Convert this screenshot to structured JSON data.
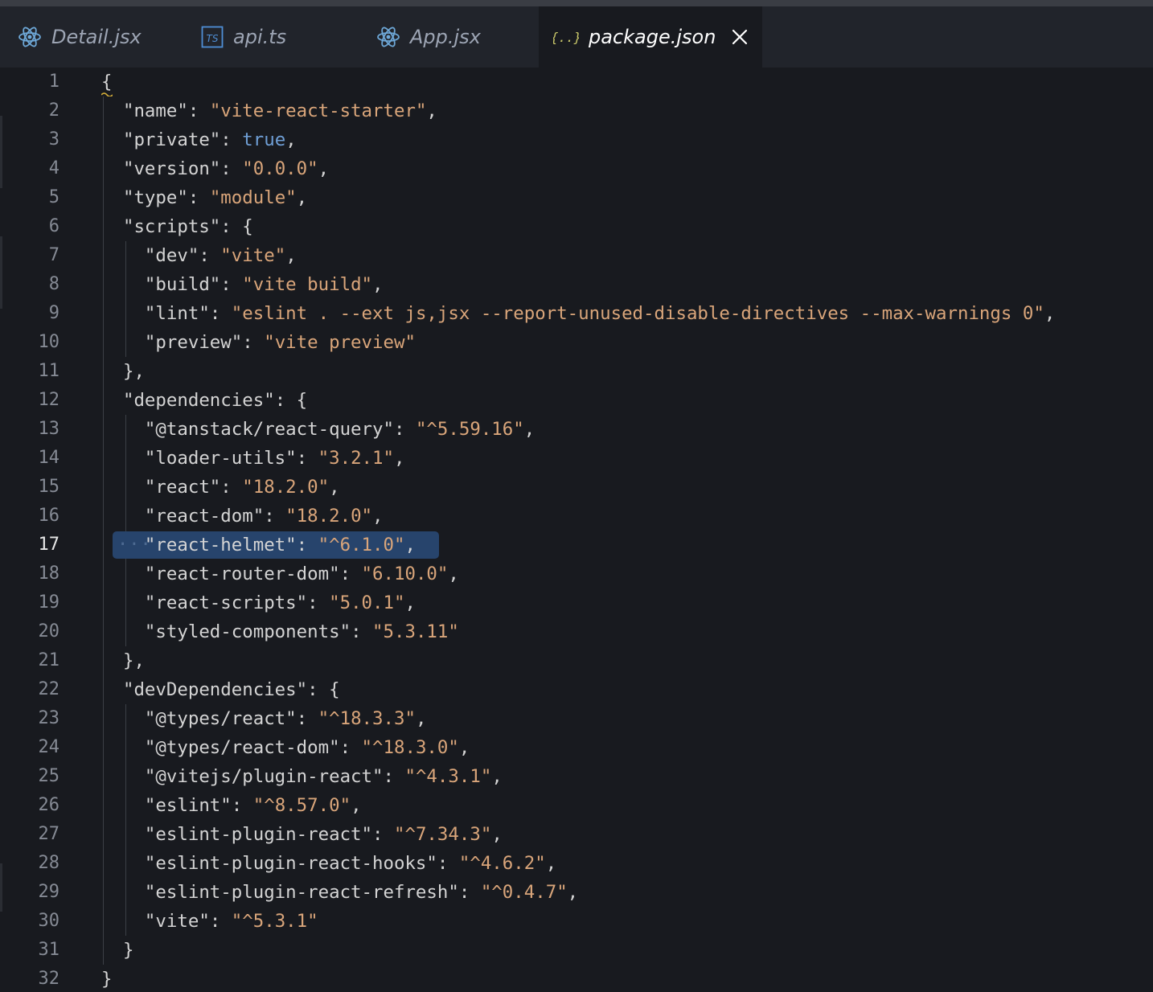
{
  "tabs": [
    {
      "label": "Detail.jsx",
      "icon": "react-icon",
      "active": false
    },
    {
      "label": "api.ts",
      "icon": "typescript-icon",
      "active": false
    },
    {
      "label": "App.jsx",
      "icon": "react-icon",
      "active": false
    },
    {
      "label": "package.json",
      "icon": "json-braces-icon",
      "active": true,
      "close_icon": "close-icon"
    }
  ],
  "editor": {
    "current_line": 17,
    "colors": {
      "background": "#181a1f",
      "string": "#d9a57a",
      "boolean": "#6f9fd6",
      "key": "#d4d4d4",
      "selection": "#27446c"
    },
    "lines": [
      {
        "n": "1",
        "tokens": [
          [
            "p",
            "{"
          ]
        ]
      },
      {
        "n": "2",
        "tokens": [
          [
            "k",
            "  \"name\""
          ],
          [
            "p",
            ": "
          ],
          [
            "s",
            "\"vite-react-starter\""
          ],
          [
            "p",
            ","
          ]
        ]
      },
      {
        "n": "3",
        "tokens": [
          [
            "k",
            "  \"private\""
          ],
          [
            "p",
            ": "
          ],
          [
            "b",
            "true"
          ],
          [
            "p",
            ","
          ]
        ]
      },
      {
        "n": "4",
        "tokens": [
          [
            "k",
            "  \"version\""
          ],
          [
            "p",
            ": "
          ],
          [
            "s",
            "\"0.0.0\""
          ],
          [
            "p",
            ","
          ]
        ]
      },
      {
        "n": "5",
        "tokens": [
          [
            "k",
            "  \"type\""
          ],
          [
            "p",
            ": "
          ],
          [
            "s",
            "\"module\""
          ],
          [
            "p",
            ","
          ]
        ]
      },
      {
        "n": "6",
        "tokens": [
          [
            "k",
            "  \"scripts\""
          ],
          [
            "p",
            ": {"
          ]
        ]
      },
      {
        "n": "7",
        "tokens": [
          [
            "k",
            "    \"dev\""
          ],
          [
            "p",
            ": "
          ],
          [
            "s",
            "\"vite\""
          ],
          [
            "p",
            ","
          ]
        ]
      },
      {
        "n": "8",
        "tokens": [
          [
            "k",
            "    \"build\""
          ],
          [
            "p",
            ": "
          ],
          [
            "s",
            "\"vite build\""
          ],
          [
            "p",
            ","
          ]
        ]
      },
      {
        "n": "9",
        "tokens": [
          [
            "k",
            "    \"lint\""
          ],
          [
            "p",
            ": "
          ],
          [
            "s",
            "\"eslint . --ext js,jsx --report-unused-disable-directives --max-warnings 0\""
          ],
          [
            "p",
            ","
          ]
        ]
      },
      {
        "n": "10",
        "tokens": [
          [
            "k",
            "    \"preview\""
          ],
          [
            "p",
            ": "
          ],
          [
            "s",
            "\"vite preview\""
          ]
        ]
      },
      {
        "n": "11",
        "tokens": [
          [
            "p",
            "  },"
          ]
        ]
      },
      {
        "n": "12",
        "tokens": [
          [
            "k",
            "  \"dependencies\""
          ],
          [
            "p",
            ": {"
          ]
        ]
      },
      {
        "n": "13",
        "tokens": [
          [
            "k",
            "    \"@tanstack/react-query\""
          ],
          [
            "p",
            ": "
          ],
          [
            "s",
            "\"^5.59.16\""
          ],
          [
            "p",
            ","
          ]
        ]
      },
      {
        "n": "14",
        "tokens": [
          [
            "k",
            "    \"loader-utils\""
          ],
          [
            "p",
            ": "
          ],
          [
            "s",
            "\"3.2.1\""
          ],
          [
            "p",
            ","
          ]
        ]
      },
      {
        "n": "15",
        "tokens": [
          [
            "k",
            "    \"react\""
          ],
          [
            "p",
            ": "
          ],
          [
            "s",
            "\"18.2.0\""
          ],
          [
            "p",
            ","
          ]
        ]
      },
      {
        "n": "16",
        "tokens": [
          [
            "k",
            "    \"react-dom\""
          ],
          [
            "p",
            ": "
          ],
          [
            "s",
            "\"18.2.0\""
          ],
          [
            "p",
            ","
          ]
        ]
      },
      {
        "n": "17",
        "tokens": [
          [
            "k",
            "    \"react-helmet\""
          ],
          [
            "p",
            ": "
          ],
          [
            "s",
            "\"^6.1.0\""
          ],
          [
            "p",
            ","
          ]
        ]
      },
      {
        "n": "18",
        "tokens": [
          [
            "k",
            "    \"react-router-dom\""
          ],
          [
            "p",
            ": "
          ],
          [
            "s",
            "\"6.10.0\""
          ],
          [
            "p",
            ","
          ]
        ]
      },
      {
        "n": "19",
        "tokens": [
          [
            "k",
            "    \"react-scripts\""
          ],
          [
            "p",
            ": "
          ],
          [
            "s",
            "\"5.0.1\""
          ],
          [
            "p",
            ","
          ]
        ]
      },
      {
        "n": "20",
        "tokens": [
          [
            "k",
            "    \"styled-components\""
          ],
          [
            "p",
            ": "
          ],
          [
            "s",
            "\"5.3.11\""
          ]
        ]
      },
      {
        "n": "21",
        "tokens": [
          [
            "p",
            "  },"
          ]
        ]
      },
      {
        "n": "22",
        "tokens": [
          [
            "k",
            "  \"devDependencies\""
          ],
          [
            "p",
            ": {"
          ]
        ]
      },
      {
        "n": "23",
        "tokens": [
          [
            "k",
            "    \"@types/react\""
          ],
          [
            "p",
            ": "
          ],
          [
            "s",
            "\"^18.3.3\""
          ],
          [
            "p",
            ","
          ]
        ]
      },
      {
        "n": "24",
        "tokens": [
          [
            "k",
            "    \"@types/react-dom\""
          ],
          [
            "p",
            ": "
          ],
          [
            "s",
            "\"^18.3.0\""
          ],
          [
            "p",
            ","
          ]
        ]
      },
      {
        "n": "25",
        "tokens": [
          [
            "k",
            "    \"@vitejs/plugin-react\""
          ],
          [
            "p",
            ": "
          ],
          [
            "s",
            "\"^4.3.1\""
          ],
          [
            "p",
            ","
          ]
        ]
      },
      {
        "n": "26",
        "tokens": [
          [
            "k",
            "    \"eslint\""
          ],
          [
            "p",
            ": "
          ],
          [
            "s",
            "\"^8.57.0\""
          ],
          [
            "p",
            ","
          ]
        ]
      },
      {
        "n": "27",
        "tokens": [
          [
            "k",
            "    \"eslint-plugin-react\""
          ],
          [
            "p",
            ": "
          ],
          [
            "s",
            "\"^7.34.3\""
          ],
          [
            "p",
            ","
          ]
        ]
      },
      {
        "n": "28",
        "tokens": [
          [
            "k",
            "    \"eslint-plugin-react-hooks\""
          ],
          [
            "p",
            ": "
          ],
          [
            "s",
            "\"^4.6.2\""
          ],
          [
            "p",
            ","
          ]
        ]
      },
      {
        "n": "29",
        "tokens": [
          [
            "k",
            "    \"eslint-plugin-react-refresh\""
          ],
          [
            "p",
            ": "
          ],
          [
            "s",
            "\"^0.4.7\""
          ],
          [
            "p",
            ","
          ]
        ]
      },
      {
        "n": "30",
        "tokens": [
          [
            "k",
            "    \"vite\""
          ],
          [
            "p",
            ": "
          ],
          [
            "s",
            "\"^5.3.1\""
          ]
        ]
      },
      {
        "n": "31",
        "tokens": [
          [
            "p",
            "  }"
          ]
        ]
      },
      {
        "n": "32",
        "tokens": [
          [
            "p",
            "}"
          ]
        ]
      }
    ]
  }
}
